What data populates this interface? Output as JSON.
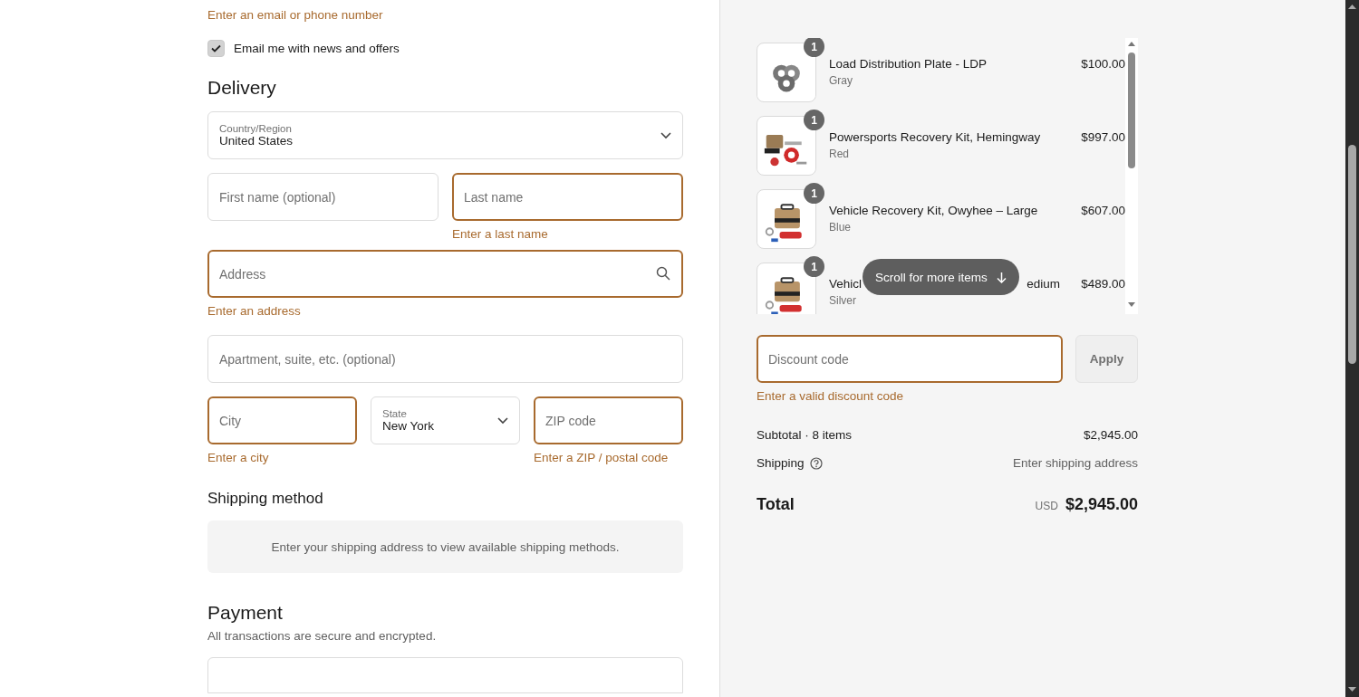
{
  "contact": {
    "error": "Enter an email or phone number",
    "newsletter": {
      "label": "Email me with news and offers",
      "checked": true
    }
  },
  "delivery": {
    "title": "Delivery",
    "country": {
      "label": "Country/Region",
      "value": "United States"
    },
    "first_name": {
      "placeholder": "First name (optional)",
      "invalid": false
    },
    "last_name": {
      "placeholder": "Last name",
      "invalid": true,
      "error": "Enter a last name"
    },
    "address": {
      "placeholder": "Address",
      "invalid": true,
      "error": "Enter an address"
    },
    "apartment": {
      "placeholder": "Apartment, suite, etc. (optional)",
      "invalid": false
    },
    "city": {
      "placeholder": "City",
      "invalid": true,
      "error": "Enter a city"
    },
    "state": {
      "label": "State",
      "value": "New York"
    },
    "zip": {
      "placeholder": "ZIP code",
      "invalid": true,
      "error": "Enter a ZIP / postal code"
    }
  },
  "shipping_method": {
    "title": "Shipping method",
    "message": "Enter your shipping address to view available shipping methods."
  },
  "payment": {
    "title": "Payment",
    "subtitle": "All transactions are secure and encrypted."
  },
  "order": {
    "items": [
      {
        "quantity": "1",
        "name": "Load Distribution Plate - LDP",
        "variant": "Gray",
        "price": "$100.00",
        "kind": "plate"
      },
      {
        "quantity": "1",
        "name": "Powersports Recovery Kit, Hemingway",
        "variant": "Red",
        "price": "$997.00",
        "kind": "kit"
      },
      {
        "quantity": "1",
        "name": "Vehicle Recovery Kit, Owyhee – Large",
        "variant": "Blue",
        "price": "$607.00",
        "kind": "bag"
      },
      {
        "quantity": "1",
        "name_visible": [
          "Vehicl",
          "edium"
        ],
        "variant": "Silver",
        "price": "$489.00",
        "kind": "bag"
      }
    ],
    "scroll_hint": "Scroll for more items",
    "discount": {
      "placeholder": "Discount code",
      "invalid": true,
      "error": "Enter a valid discount code",
      "button": "Apply"
    },
    "subtotal": {
      "label": "Subtotal · 8 items",
      "value": "$2,945.00"
    },
    "shipping": {
      "label": "Shipping",
      "value": "Enter shipping address"
    },
    "total": {
      "label": "Total",
      "currency": "USD",
      "value": "$2,945.00"
    }
  }
}
